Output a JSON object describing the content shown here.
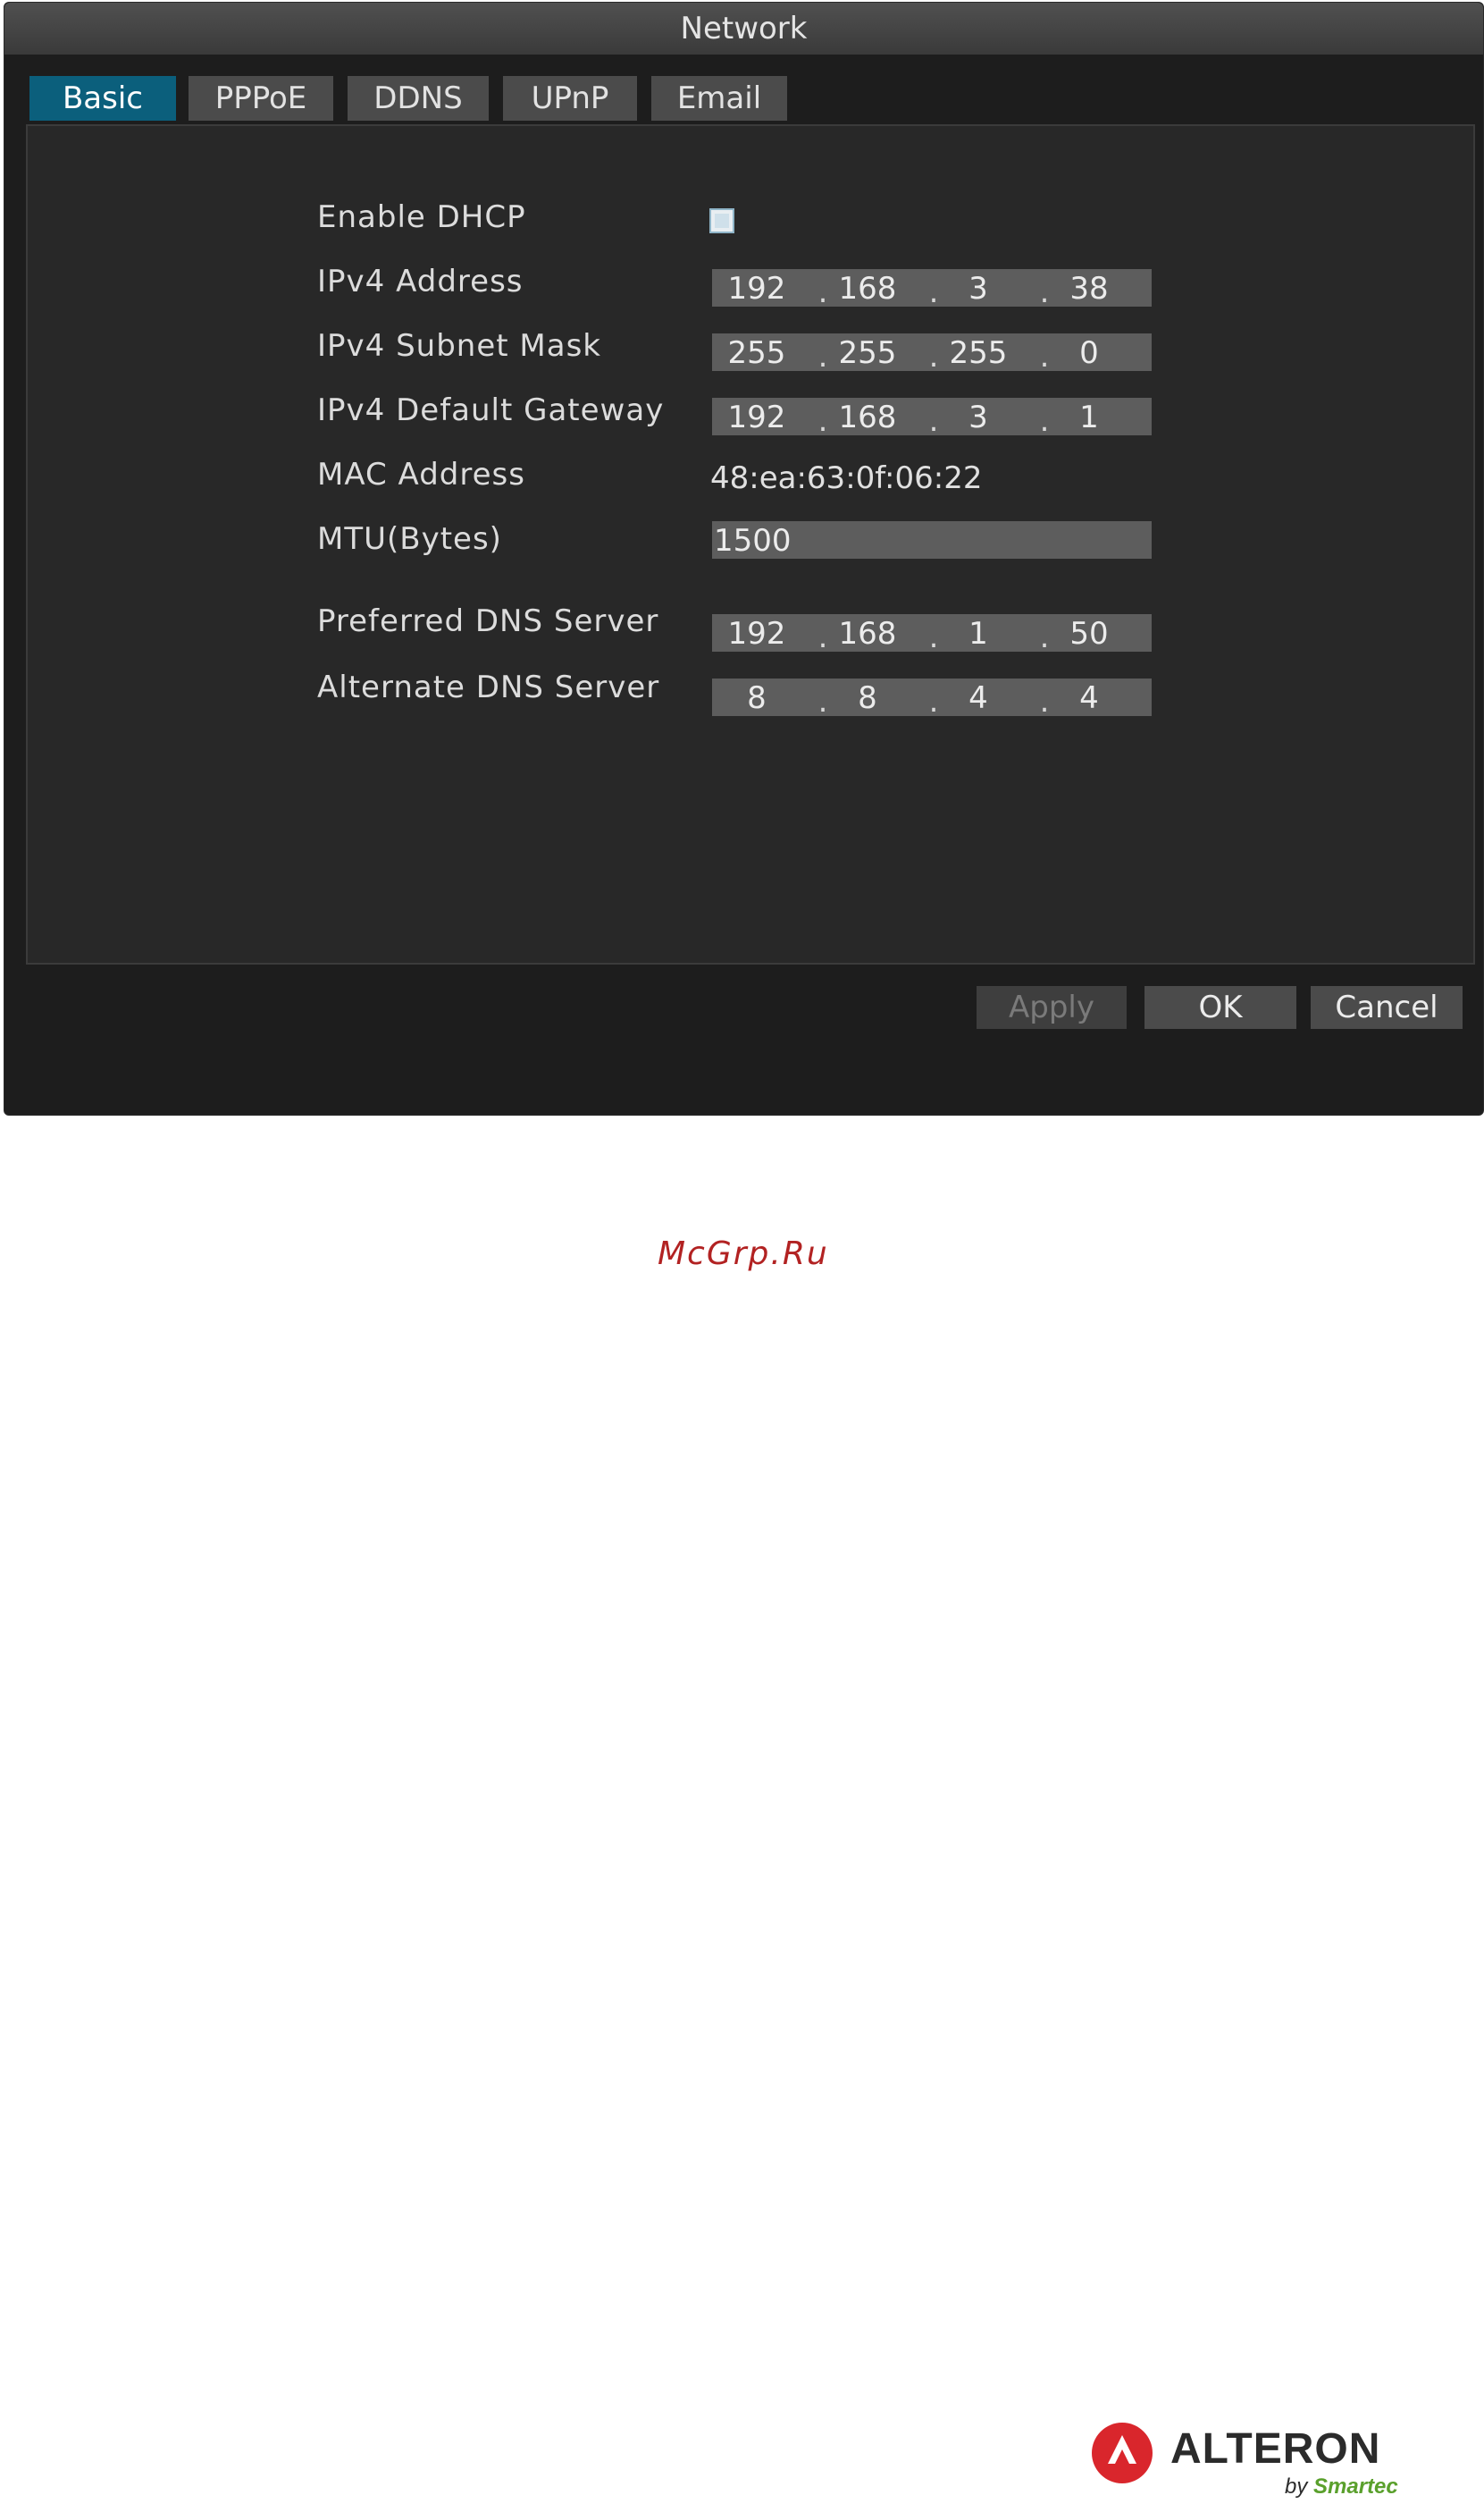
{
  "window": {
    "title": "Network"
  },
  "tabs": [
    {
      "label": "Basic",
      "active": true
    },
    {
      "label": "PPPoE",
      "active": false
    },
    {
      "label": "DDNS",
      "active": false
    },
    {
      "label": "UPnP",
      "active": false
    },
    {
      "label": "Email",
      "active": false
    }
  ],
  "form": {
    "dhcp": {
      "label": "Enable DHCP",
      "checked": false
    },
    "ipv4_address": {
      "label": "IPv4 Address",
      "octets": [
        "192",
        "168",
        "3",
        "38"
      ]
    },
    "subnet_mask": {
      "label": "IPv4 Subnet Mask",
      "octets": [
        "255",
        "255",
        "255",
        "0"
      ]
    },
    "gateway": {
      "label": "IPv4 Default Gateway",
      "octets": [
        "192",
        "168",
        "3",
        "1"
      ]
    },
    "mac": {
      "label": "MAC Address",
      "value": "48:ea:63:0f:06:22"
    },
    "mtu": {
      "label": "MTU(Bytes)",
      "value": "1500"
    },
    "preferred_dns": {
      "label": "Preferred DNS Server",
      "octets": [
        "192",
        "168",
        "1",
        "50"
      ]
    },
    "alternate_dns": {
      "label": "Alternate DNS Server",
      "octets": [
        "8",
        "8",
        "4",
        "4"
      ]
    },
    "separator": "."
  },
  "buttons": {
    "apply": "Apply",
    "ok": "OK",
    "cancel": "Cancel"
  },
  "watermark": "McGrp.Ru",
  "logo": {
    "name": "ALTERON",
    "by": "by",
    "brand": "Smartec",
    "brand_color": "#5aa02c",
    "mark_color": "#d9262c"
  }
}
